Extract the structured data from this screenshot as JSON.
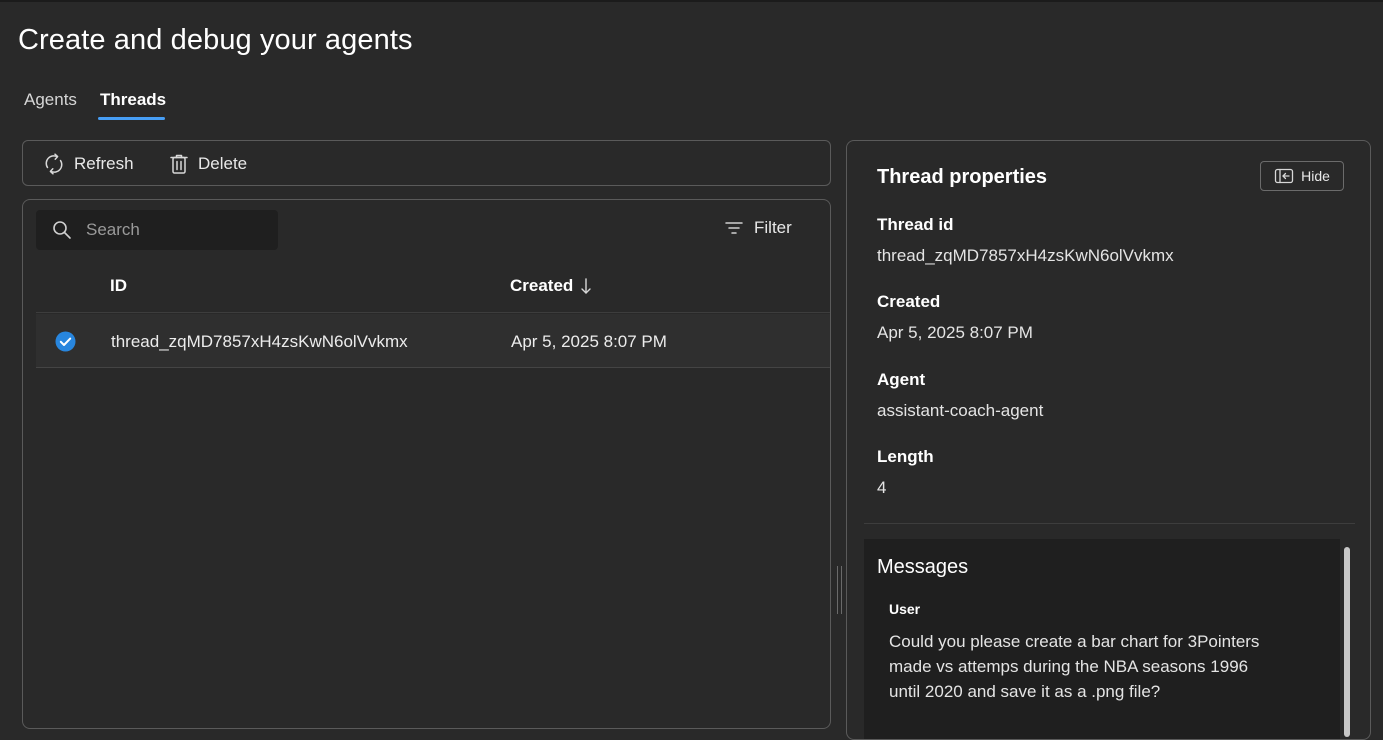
{
  "page": {
    "title": "Create and debug your agents"
  },
  "tabs": [
    {
      "label": "Agents",
      "selected": false
    },
    {
      "label": "Threads",
      "selected": true
    }
  ],
  "toolbar": {
    "refresh_label": "Refresh",
    "delete_label": "Delete"
  },
  "list": {
    "search_placeholder": "Search",
    "filter_label": "Filter",
    "columns": {
      "id": "ID",
      "created": "Created"
    },
    "sort": "created-descending",
    "rows": [
      {
        "id": "thread_zqMD7857xH4zsKwN6olVvkmx",
        "created": "Apr 5, 2025 8:07 PM",
        "selected": true
      }
    ]
  },
  "properties": {
    "title": "Thread properties",
    "hide_label": "Hide",
    "fields": [
      {
        "label": "Thread id",
        "value": "thread_zqMD7857xH4zsKwN6olVvkmx"
      },
      {
        "label": "Created",
        "value": "Apr 5, 2025 8:07 PM"
      },
      {
        "label": "Agent",
        "value": "assistant-coach-agent"
      },
      {
        "label": "Length",
        "value": "4"
      }
    ],
    "messages": {
      "title": "Messages",
      "items": [
        {
          "role": "User",
          "text": "Could you please create a bar chart for 3Pointers made vs attemps during the NBA seasons 1996 until 2020 and save it as a .png file?"
        }
      ]
    }
  },
  "colors": {
    "accent": "#479ef5",
    "background": "#292929",
    "border": "#5a5a5a",
    "check": "#2886de"
  }
}
